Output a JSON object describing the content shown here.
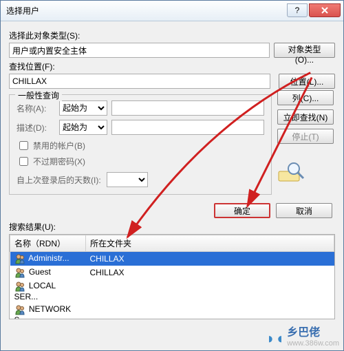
{
  "window": {
    "title": "选择用户"
  },
  "section1": {
    "object_types_label": "选择此对象类型(S):",
    "object_types_value": "用户或内置安全主体",
    "object_types_btn": "对象类型(O)...",
    "location_label": "查找位置(F):",
    "location_value": "CHILLAX",
    "location_btn": "位置(L)..."
  },
  "general": {
    "legend": "一般性查询",
    "name_label": "名称(A):",
    "desc_label": "描述(D):",
    "match_option": "起始为",
    "disabled_accounts": "禁用的帐户(B)",
    "non_expiring_pw": "不过期密码(X)",
    "days_since_login": "自上次登录后的天数(I):"
  },
  "side_buttons": {
    "columns": "列(C)...",
    "find_now": "立即查找(N)",
    "stop": "停止(T)"
  },
  "footer": {
    "ok": "确定",
    "cancel": "取消"
  },
  "results": {
    "label": "搜索结果(U):",
    "col_name": "名称（RDN）",
    "col_folder": "所在文件夹",
    "rows": [
      {
        "name": "Administr...",
        "folder": "CHILLAX",
        "selected": true
      },
      {
        "name": "Guest",
        "folder": "CHILLAX",
        "selected": false
      },
      {
        "name": "LOCAL SER...",
        "folder": "",
        "selected": false
      },
      {
        "name": "NETWORK S...",
        "folder": "",
        "selected": false
      }
    ]
  },
  "watermark": {
    "brand": "乡巴佬",
    "url": "www.386w.com"
  }
}
